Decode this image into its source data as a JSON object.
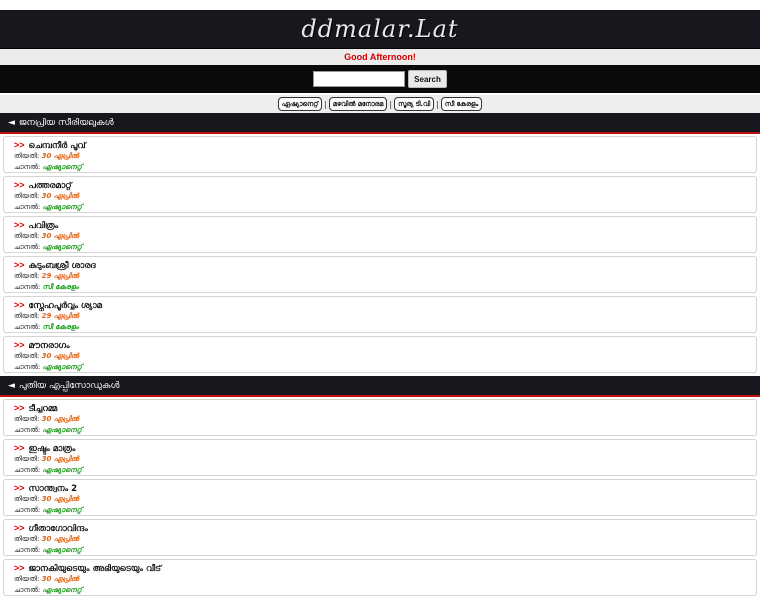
{
  "site": {
    "logo": "ddmalar.Lat",
    "greeting": "Good Afternoon!"
  },
  "search": {
    "placeholder": "",
    "button_label": "Search"
  },
  "channels": [
    {
      "label": "ഏഷ്യാനെറ്റ്"
    },
    {
      "label": "മഴവിൽ മനോരമ"
    },
    {
      "label": "സൂര്യ ടി.വി"
    },
    {
      "label": "സീ കേരളം"
    }
  ],
  "labels": {
    "date": "തിയതി:",
    "channel": "ചാനൽ:",
    "arrows": ">>"
  },
  "sections": [
    {
      "title": "ജനപ്രിയ സീരിയലുകൾ",
      "items": [
        {
          "title": "ചെമ്പനീർ പൂവ്",
          "date": "30 ഏപ്രിൽ",
          "channel": "ഏഷ്യാനെറ്റ്"
        },
        {
          "title": "പത്തരമാറ്റ്",
          "date": "30 ഏപ്രിൽ",
          "channel": "ഏഷ്യാനെറ്റ്"
        },
        {
          "title": "പവിത്രം",
          "date": "30 ഏപ്രിൽ",
          "channel": "ഏഷ്യാനെറ്റ്"
        },
        {
          "title": "കുടുംബശ്രീ ശാരദ",
          "date": "29 ഏപ്രിൽ",
          "channel": "സീ കേരളം"
        },
        {
          "title": "സ്നേഹപൂർവ്വം ശ്യാമ",
          "date": "29 ഏപ്രിൽ",
          "channel": "സീ കേരളം"
        },
        {
          "title": "മൗനരാഗം",
          "date": "30 ഏപ്രിൽ",
          "channel": "ഏഷ്യാനെറ്റ്"
        }
      ]
    },
    {
      "title": "പുതിയ എപ്പിസോഡുകൾ",
      "items": [
        {
          "title": "ടീച്ചറമ്മ",
          "date": "30 ഏപ്രിൽ",
          "channel": "ഏഷ്യാനെറ്റ്"
        },
        {
          "title": "ഇഷ്ടം മാത്രം",
          "date": "30 ഏപ്രിൽ",
          "channel": "ഏഷ്യാനെറ്റ്"
        },
        {
          "title": "സാന്ത്വനം 2",
          "date": "30 ഏപ്രിൽ",
          "channel": "ഏഷ്യാനെറ്റ്"
        },
        {
          "title": "ഗീതാഗോവിന്ദം",
          "date": "30 ഏപ്രിൽ",
          "channel": "ഏഷ്യാനെറ്റ്"
        },
        {
          "title": "ജാനകിയുടെയും അഭിയുടെയും വീട്",
          "date": "30 ഏപ്രിൽ",
          "channel": "ഏഷ്യാനെറ്റ്"
        }
      ]
    }
  ],
  "colors": {
    "header_bg": "#16181e",
    "accent_red": "#e00000",
    "date": "#e06010",
    "channel": "#1a9a1a"
  }
}
